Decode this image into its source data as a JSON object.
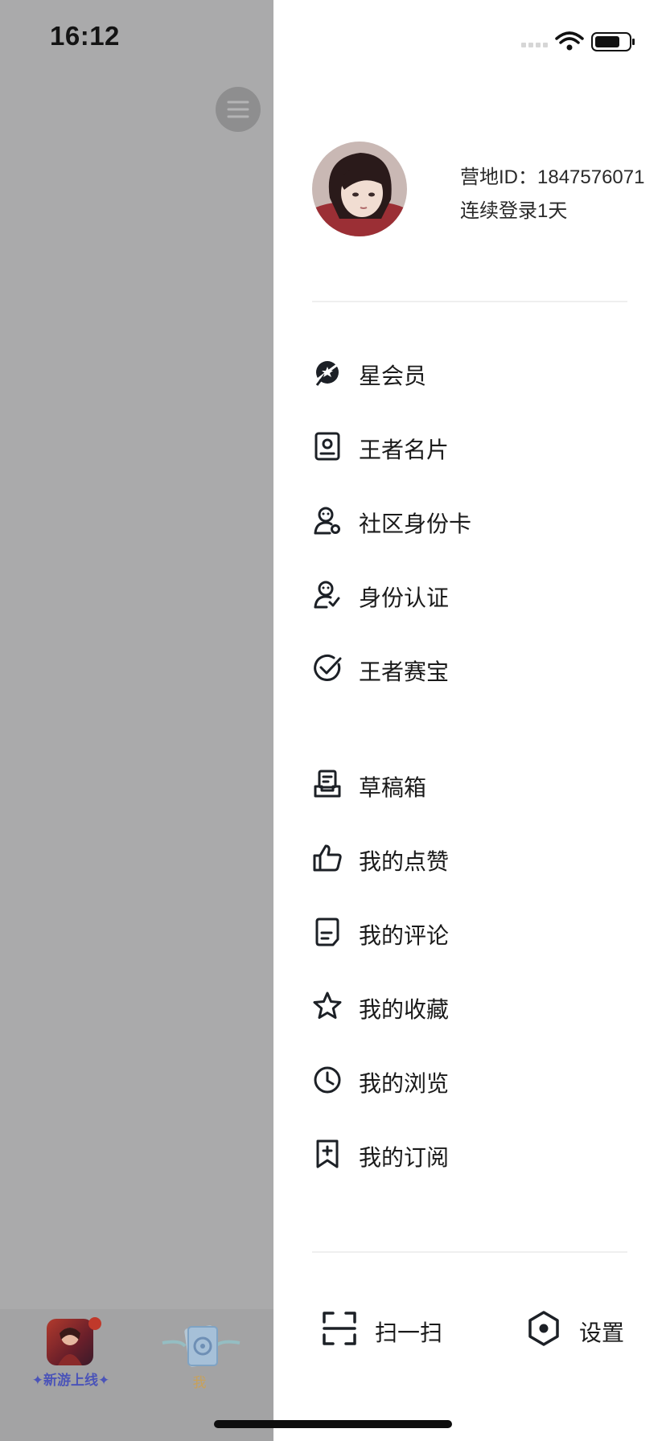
{
  "status_bar": {
    "time": "16:12"
  },
  "profile": {
    "id_text": "营地ID：1847576071",
    "login_text": "连续登录1天"
  },
  "menu_group_1": [
    {
      "label": "星会员",
      "icon": "star-member-icon"
    },
    {
      "label": "王者名片",
      "icon": "name-card-icon"
    },
    {
      "label": "社区身份卡",
      "icon": "community-id-icon"
    },
    {
      "label": "身份认证",
      "icon": "verify-icon"
    },
    {
      "label": "王者赛宝",
      "icon": "check-circle-icon"
    }
  ],
  "menu_group_2": [
    {
      "label": "草稿箱",
      "icon": "draft-box-icon"
    },
    {
      "label": "我的点赞",
      "icon": "thumbs-up-icon"
    },
    {
      "label": "我的评论",
      "icon": "comment-doc-icon"
    },
    {
      "label": "我的收藏",
      "icon": "star-icon"
    },
    {
      "label": "我的浏览",
      "icon": "clock-icon"
    },
    {
      "label": "我的订阅",
      "icon": "bookmark-plus-icon"
    }
  ],
  "bottom_actions": {
    "scan_label": "扫一扫",
    "settings_label": "设置"
  },
  "tabbar": {
    "game_label": "✦新游上线✦",
    "me_label": "我"
  },
  "colors": {
    "overlay": "#aaaaab",
    "drawer_bg": "#ffffff",
    "text": "#1a1a1a",
    "tab_game_label": "#4b54b8",
    "tab_me_label": "#c8a15a"
  }
}
